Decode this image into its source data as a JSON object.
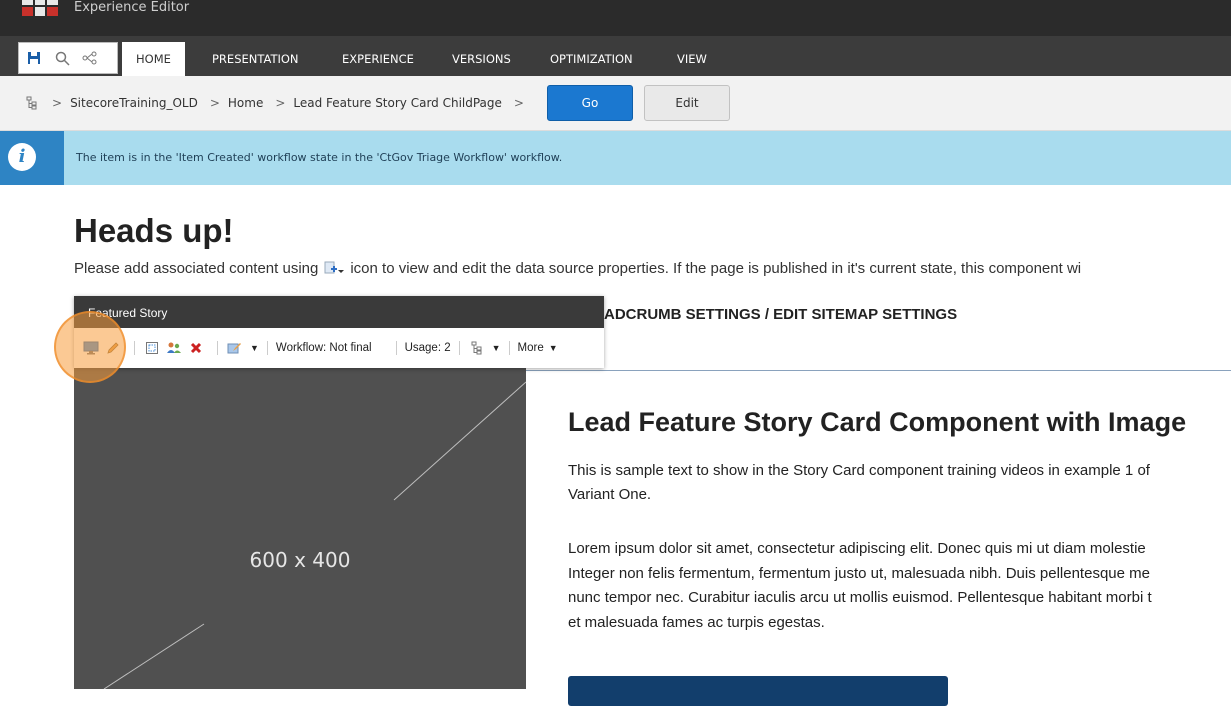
{
  "app": {
    "title": "Experience Editor"
  },
  "ribbon": {
    "tabs": [
      {
        "label": "HOME",
        "active": true
      },
      {
        "label": "PRESENTATION"
      },
      {
        "label": "EXPERIENCE"
      },
      {
        "label": "VERSIONS"
      },
      {
        "label": "OPTIMIZATION"
      },
      {
        "label": "VIEW"
      }
    ],
    "quick_access_icons": [
      "save-icon",
      "search-icon",
      "share-tree-icon"
    ]
  },
  "breadcrumb": {
    "items": [
      "SitecoreTraining_OLD",
      "Home",
      "Lead Feature Story Card ChildPage"
    ],
    "separator": ">",
    "go_label": "Go",
    "edit_label": "Edit"
  },
  "info": {
    "message": "The item is in the 'Item Created' workflow state in the 'CtGov Triage Workflow' workflow."
  },
  "page": {
    "heading": "Heads up!",
    "notice_before": "Please add associated content using",
    "notice_after": "icon to view and edit the data source properties. If the page is published in it's current state, this component wi",
    "settings_text": "ADCRUMB SETTINGS / EDIT SITEMAP SETTINGS"
  },
  "chrome": {
    "title": "Featured Story",
    "workflow_label": "Workflow: Not final",
    "usage_label": "Usage: 2",
    "more_label": "More"
  },
  "card": {
    "image_placeholder": "600 x 400",
    "title": "Lead Feature Story Card Component with Image",
    "paragraph1_line1": "This is sample text to show in the Story Card component training videos in example 1 of",
    "paragraph1_line2": "Variant One.",
    "paragraph2_line1": "Lorem ipsum dolor sit amet, consectetur adipiscing elit. Donec quis mi ut diam molestie",
    "paragraph2_line2": "Integer non felis fermentum, fermentum justo ut, malesuada nibh. Duis pellentesque me",
    "paragraph2_line3": "nunc tempor nec. Curabitur iaculis arcu ut mollis euismod. Pellentesque habitant morbi t",
    "paragraph2_line4": "et malesuada fames ac turpis egestas."
  },
  "colors": {
    "topbar": "#2b2b2b",
    "ribbon": "#3c3c3c",
    "go_button": "#1b78d0",
    "info_bar": "#a9dcee",
    "info_icon": "#2e84c4",
    "highlight": "#f79c3c",
    "cta": "#123e6c"
  }
}
